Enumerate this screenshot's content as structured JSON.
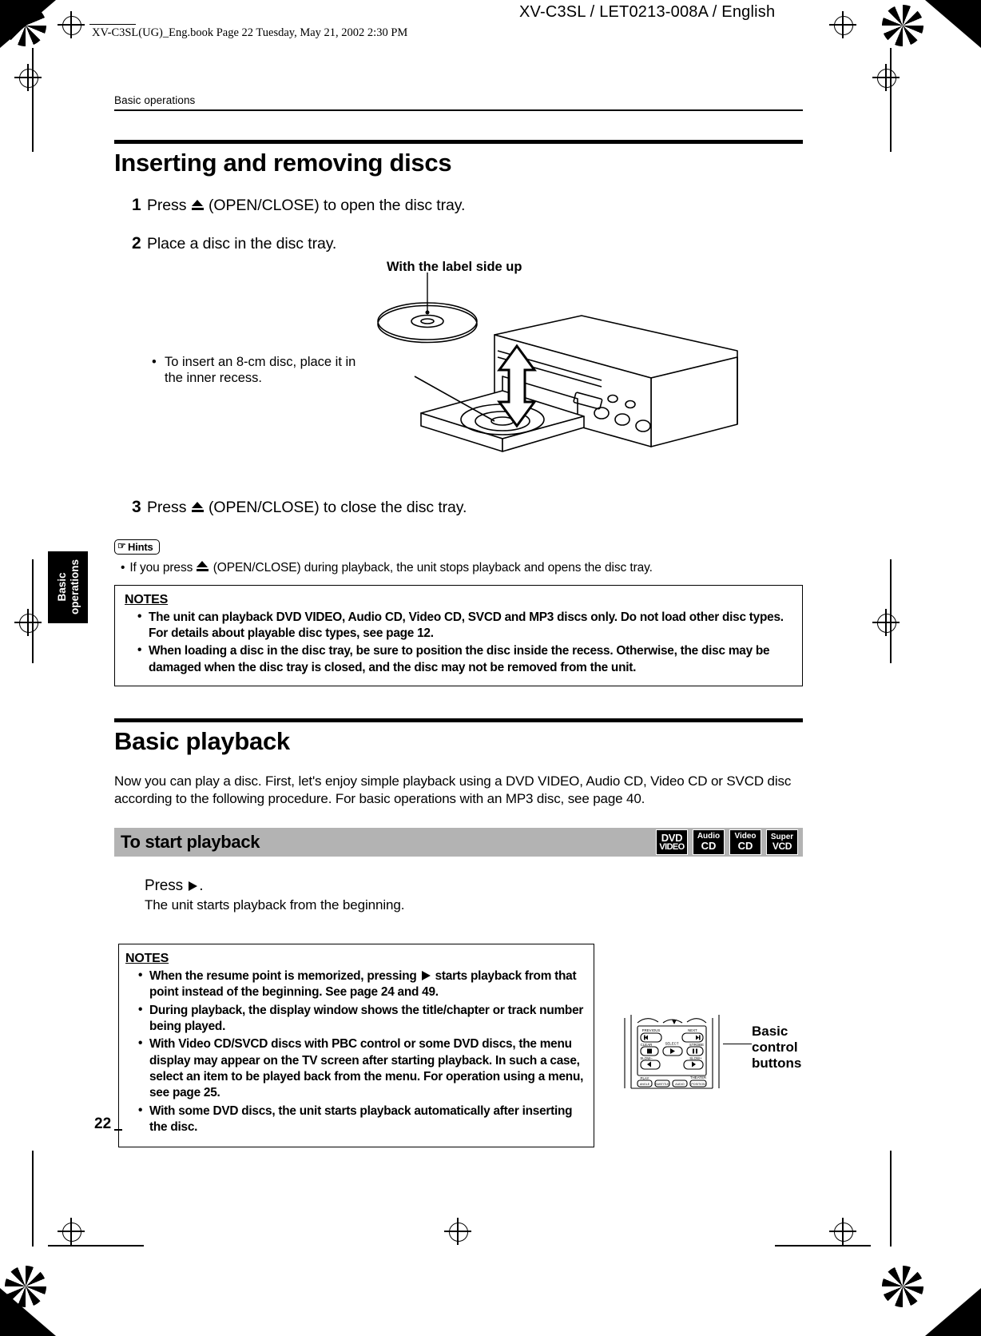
{
  "page": {
    "doc_id": "XV-C3SL / LET0213-008A / English",
    "book_stamp": "XV-C3SL(UG)_Eng.book  Page 22  Tuesday, May 21, 2002  2:30 PM",
    "breadcrumb": "Basic operations",
    "folio": "22",
    "side_tab_line1": "Basic",
    "side_tab_line2": "operations",
    "gray_bar_color": "#b3b3b3"
  },
  "section1": {
    "title": "Inserting and removing discs",
    "steps": [
      {
        "num": "1",
        "pre": "Press ",
        "icon": "eject-icon",
        "post": " (OPEN/CLOSE) to open the disc tray."
      },
      {
        "num": "2",
        "pre": "Place a disc in the disc tray.",
        "icon": "",
        "post": ""
      },
      {
        "num": "3",
        "pre": "Press ",
        "icon": "eject-icon",
        "post": " (OPEN/CLOSE) to close the disc tray."
      }
    ],
    "step1_text": "Press  (OPEN/CLOSE) to open the disc tray.",
    "step1_pre": "Press",
    "step1_post": "(OPEN/CLOSE) to open the disc tray.",
    "step2_text": "Place a disc in the disc tray.",
    "step3_pre": "Press",
    "step3_post": "(OPEN/CLOSE) to close the disc tray.",
    "illustration": {
      "label_up": "With the label side up",
      "recess_bullet": "•",
      "recess_note": "To insert an 8-cm disc, place it in the inner recess."
    },
    "hints": {
      "badge_label": "Hints",
      "bullet": "•",
      "item_pre": "If you press",
      "item_post": "(OPEN/CLOSE) during playback, the unit stops playback and opens the disc tray."
    },
    "notes": {
      "title": "NOTES",
      "bullet": "•",
      "items": [
        "The unit can playback DVD VIDEO, Audio CD, Video CD, SVCD and MP3 discs only. Do not load other disc types. For details about playable disc types, see page 12.",
        "When loading a disc in the disc tray, be sure to position the disc inside the recess. Otherwise, the disc may be damaged when the disc tray is closed, and the disc may not be removed from the unit."
      ]
    }
  },
  "section2": {
    "title": "Basic playback",
    "intro": "Now you can play a disc. First, let's enjoy simple playback using a DVD VIDEO, Audio CD, Video CD or SVCD disc according to the following procedure. For basic operations with an MP3 disc, see page 40.",
    "subhead": "To start playback",
    "badges": [
      {
        "line1": "DVD",
        "line2": "VIDEO",
        "name": "dvd-video-badge"
      },
      {
        "line1": "Audio",
        "line2": "CD",
        "name": "audio-cd-badge"
      },
      {
        "line1": "Video",
        "line2": "CD",
        "name": "video-cd-badge"
      },
      {
        "line1": "Super",
        "line2": "VCD",
        "name": "super-vcd-badge"
      }
    ],
    "press_pre": "Press",
    "press_post": ".",
    "press_sub": "The unit starts playback from the beginning.",
    "notes": {
      "title": "NOTES",
      "bullet": "•",
      "item1_pre": "When the resume point is memorized, pressing",
      "item1_post": "starts playback from that point instead of the beginning. See page 24 and 49.",
      "item2": "During playback, the display window shows the title/chapter or track number being played.",
      "item3": "With Video CD/SVCD discs with PBC control or some DVD discs, the menu display may appear on the TV screen after starting playback. In such a case, select an item to be played back from the menu. For operation using a menu, see page 25.",
      "item4": "With some DVD discs, the unit starts playback automatically after inserting the disc."
    },
    "remote_caption_l1": "Basic",
    "remote_caption_l2": "control",
    "remote_caption_l3": "buttons",
    "remote_labels": {
      "previous": "PREVIOUS",
      "next": "NEXT",
      "clear": "CLEAR",
      "select": "SELECT",
      "strobe": "STROBE",
      "slow_minus": "SLOW–",
      "slow_plus": "SLOW+",
      "play": "PLAY",
      "angle": "ANGLE",
      "subtitle": "SUBTITLE",
      "audio": "AUDIO",
      "theater": "THEATER",
      "position": "POSITION"
    }
  }
}
